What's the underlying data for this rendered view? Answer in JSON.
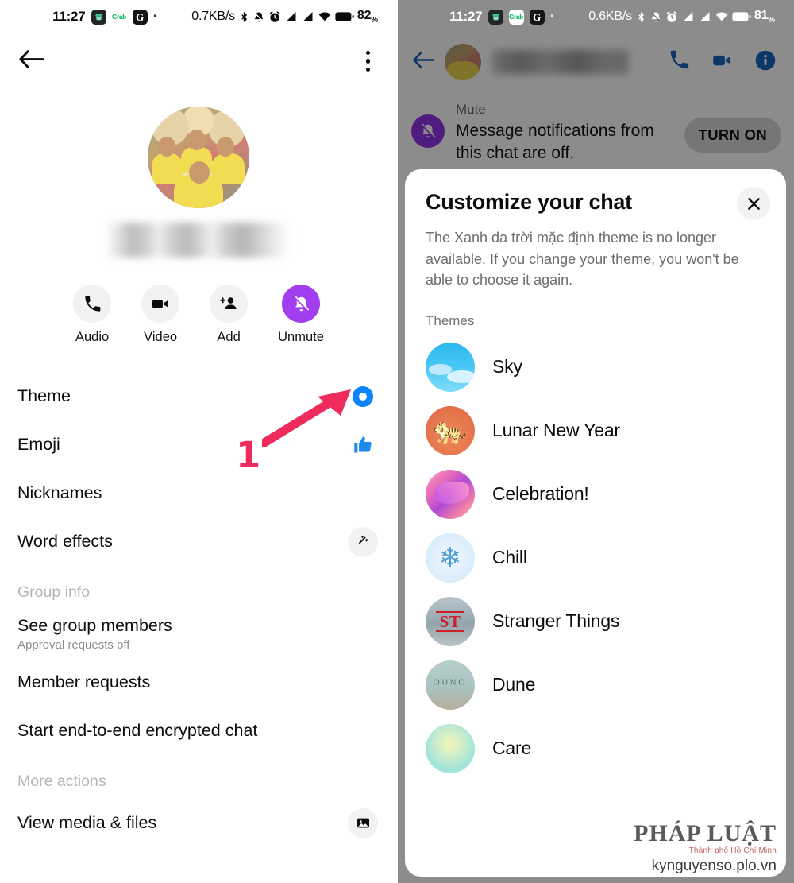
{
  "left": {
    "status": {
      "time": "11:27",
      "separator_dot": "·",
      "net_speed": "0.7KB/s",
      "battery": "82",
      "battery_unit": "%",
      "icons": [
        "cupcake-app-icon",
        "grab-app-icon",
        "google-app-icon",
        "bluetooth-icon",
        "notification-off-icon",
        "alarm-icon",
        "signal-1-icon",
        "signal-2-icon",
        "wifi-icon",
        "battery-icon"
      ]
    },
    "topbar": {
      "back": "back-arrow-icon",
      "menu": "overflow-menu-icon"
    },
    "profile": {
      "avatar": "group-photo-avatar",
      "name_redacted": ""
    },
    "actions": [
      {
        "label": "Audio",
        "icon": "phone-icon",
        "style": "light"
      },
      {
        "label": "Video",
        "icon": "video-cam-icon",
        "style": "light"
      },
      {
        "label": "Add",
        "icon": "add-person-icon",
        "style": "light"
      },
      {
        "label": "Unmute",
        "icon": "bell-off-icon",
        "style": "purple"
      }
    ],
    "rows": [
      {
        "title": "Theme",
        "sub": "",
        "trail": "blue-ring-indicator"
      },
      {
        "title": "Emoji",
        "sub": "",
        "trail": "thumbs-up-icon"
      },
      {
        "title": "Nicknames",
        "sub": "",
        "trail": ""
      },
      {
        "title": "Word effects",
        "sub": "",
        "trail": "magic-wand-icon"
      }
    ],
    "group_info_label": "Group info",
    "group_rows": [
      {
        "title": "See group members",
        "sub": "Approval requests off",
        "trail": ""
      },
      {
        "title": "Member requests",
        "sub": "",
        "trail": ""
      },
      {
        "title": "Start end-to-end encrypted chat",
        "sub": "",
        "trail": ""
      }
    ],
    "more_actions_label": "More actions",
    "more_rows": [
      {
        "title": "View media & files",
        "sub": "",
        "trail": "media-image-icon"
      }
    ],
    "annotation": {
      "number": "1",
      "arrow": "pointer-arrow",
      "color": "#ef2b5d"
    }
  },
  "right": {
    "status": {
      "time": "11:27",
      "separator_dot": "·",
      "net_speed": "0.6KB/s",
      "battery": "81",
      "battery_unit": "%"
    },
    "header": {
      "back": "back-arrow-icon",
      "avatar": "group-photo-avatar",
      "name_redacted": "",
      "call": "phone-icon",
      "video": "video-cam-icon",
      "info": "info-icon"
    },
    "mute_banner": {
      "icon": "bell-off-icon",
      "kicker": "Mute",
      "body": "Message notifications from this chat are off.",
      "button": "TURN ON"
    },
    "sheet": {
      "title": "Customize your chat",
      "close": "close-icon",
      "description": "The Xanh da trời mặc định theme is no longer available. If you change your theme, you won't be able to choose it again.",
      "themes_label": "Themes",
      "themes": [
        {
          "name": "Sky",
          "art": "th-sky"
        },
        {
          "name": "Lunar New Year",
          "art": "th-lunar"
        },
        {
          "name": "Celebration!",
          "art": "th-celeb"
        },
        {
          "name": "Chill",
          "art": "th-chill"
        },
        {
          "name": "Stranger Things",
          "art": "th-st"
        },
        {
          "name": "Dune",
          "art": "th-dune"
        },
        {
          "name": "Care",
          "art": "th-care"
        }
      ]
    },
    "watermark": {
      "brand_a": "PH",
      "brand_b": "ÁP",
      "brand_c": "LU",
      "brand_d": "ẬT",
      "brand_full": "PHÁP LUẬT",
      "tagline": "Thành phố Hồ Chí Minh",
      "url": "kynguyenso.plo.vn"
    }
  },
  "colors": {
    "accent_blue": "#0a84ff",
    "purple": "#a13ff0",
    "annotation_pink": "#ef2b5d",
    "light_grey_circle": "#f1f2f3",
    "scrim": "rgba(0,0,0,0.45)"
  }
}
